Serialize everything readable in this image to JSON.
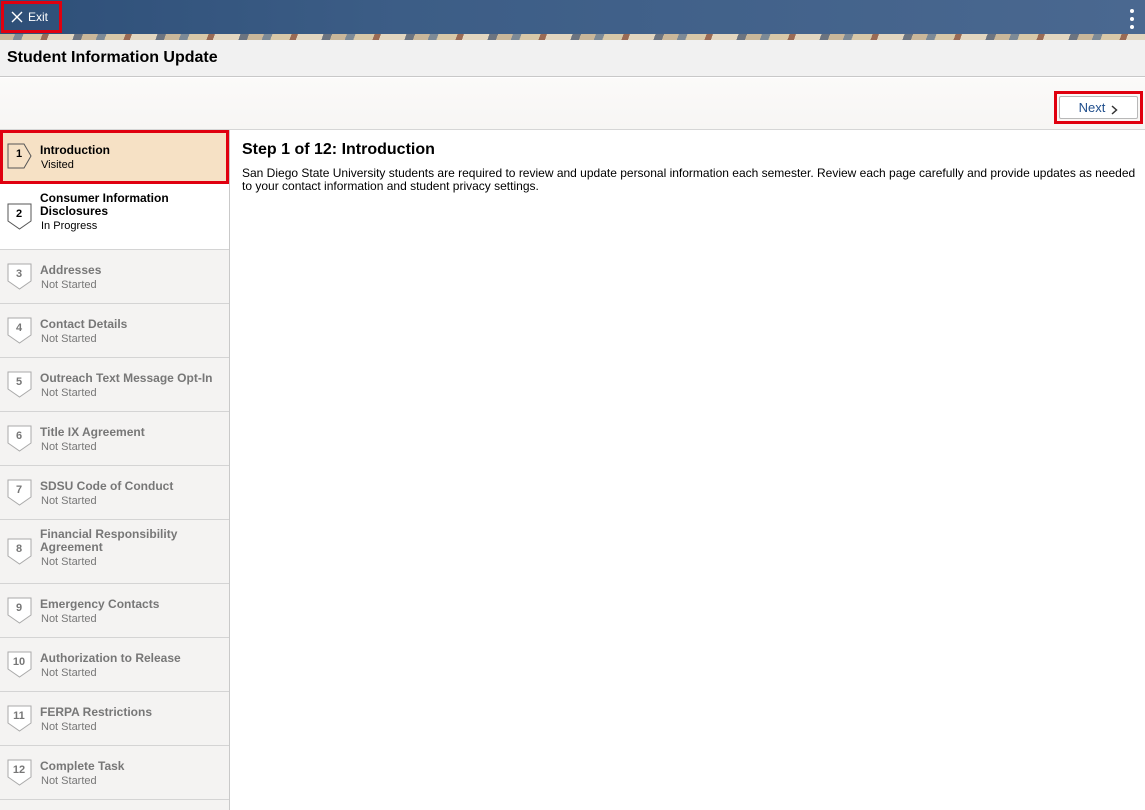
{
  "header": {
    "exit_label": "Exit",
    "title": "Student Information Update",
    "next_label": "Next"
  },
  "steps": [
    {
      "num": "1",
      "label": "Introduction",
      "status": "Visited"
    },
    {
      "num": "2",
      "label": "Consumer Information Disclosures",
      "status": "In Progress"
    },
    {
      "num": "3",
      "label": "Addresses",
      "status": "Not Started"
    },
    {
      "num": "4",
      "label": "Contact Details",
      "status": "Not Started"
    },
    {
      "num": "5",
      "label": "Outreach Text Message Opt-In",
      "status": "Not Started"
    },
    {
      "num": "6",
      "label": "Title IX Agreement",
      "status": "Not Started"
    },
    {
      "num": "7",
      "label": "SDSU Code of Conduct",
      "status": "Not Started"
    },
    {
      "num": "8",
      "label": "Financial Responsibility Agreement",
      "status": "Not Started"
    },
    {
      "num": "9",
      "label": "Emergency Contacts",
      "status": "Not Started"
    },
    {
      "num": "10",
      "label": "Authorization to Release",
      "status": "Not Started"
    },
    {
      "num": "11",
      "label": "FERPA Restrictions",
      "status": "Not Started"
    },
    {
      "num": "12",
      "label": "Complete Task",
      "status": "Not Started"
    }
  ],
  "main": {
    "heading": "Step 1 of 12: Introduction",
    "body": "San Diego State University students are required to review and update personal information each semester. Review each page carefully and provide updates as needed to your contact information and student privacy settings."
  },
  "colors": {
    "banner": "#3c5d86",
    "active_step_bg": "#f6e1c5",
    "highlight_border": "#e0000f",
    "link_blue": "#1f4e8c"
  }
}
